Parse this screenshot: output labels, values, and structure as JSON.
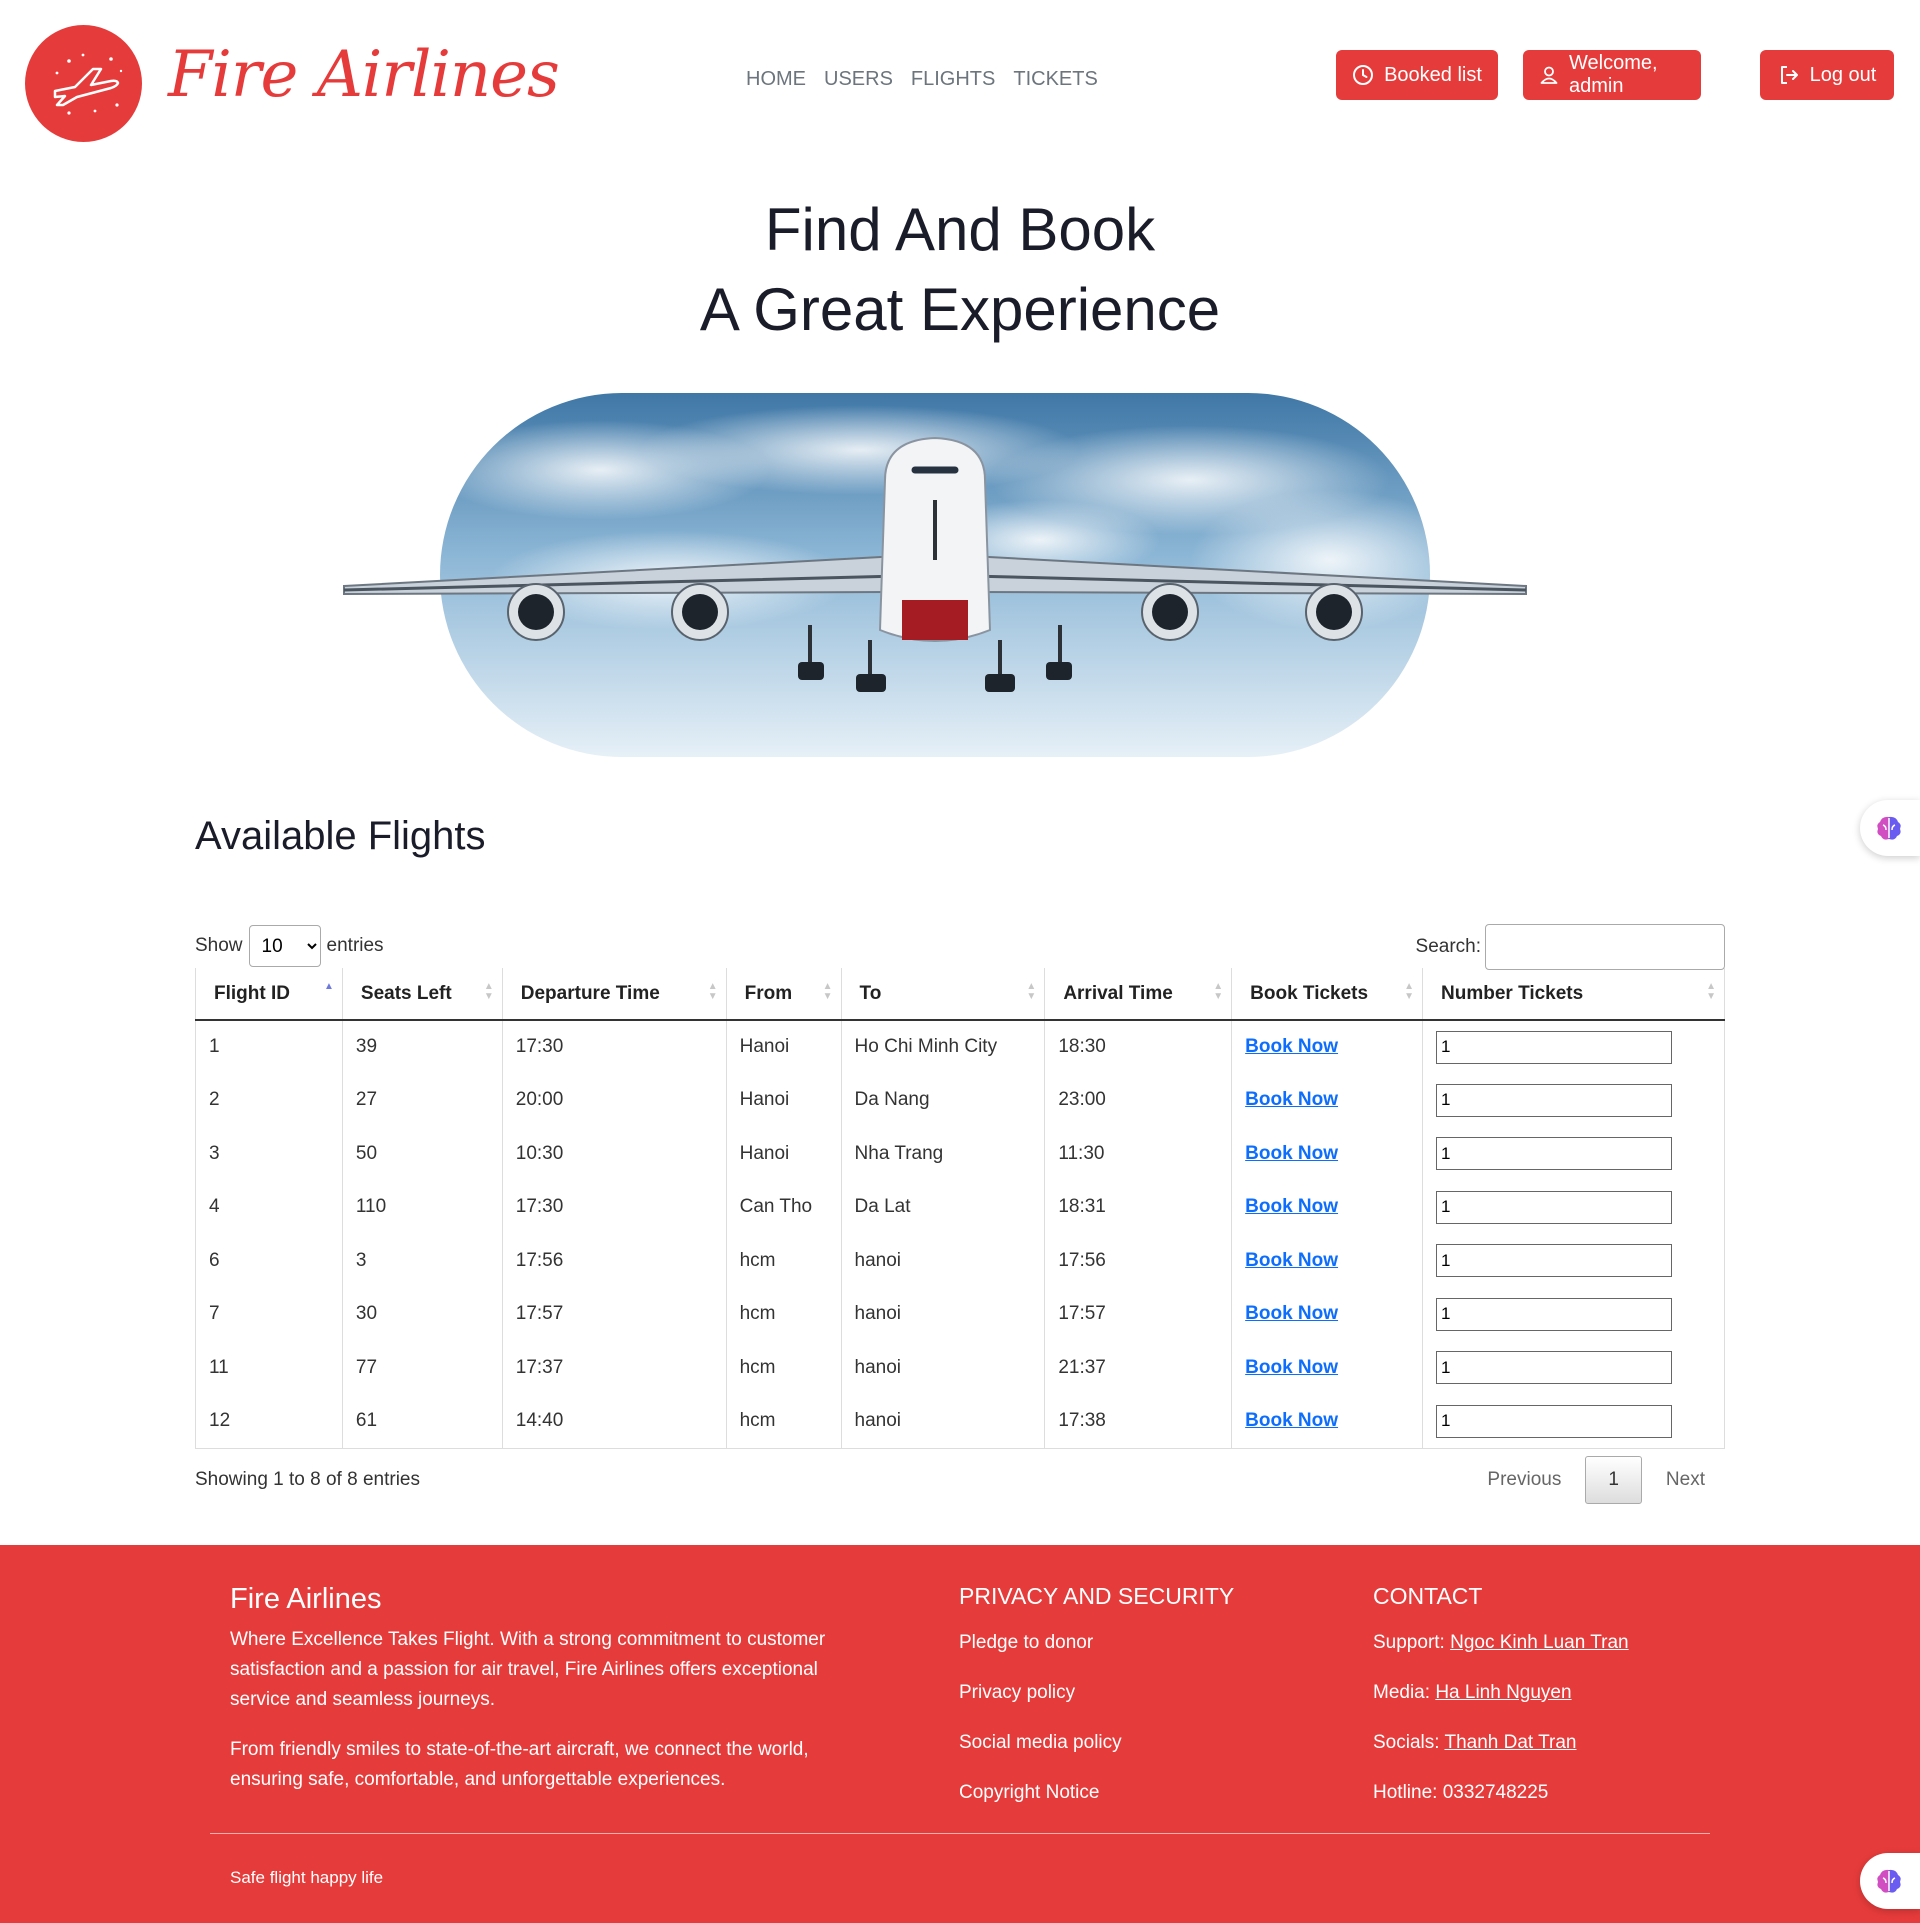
{
  "brand": {
    "name": "Fire Airlines",
    "logo_icon": "plane-logo"
  },
  "nav": [
    "HOME",
    "USERS",
    "FLIGHTS",
    "TICKETS"
  ],
  "header_buttons": {
    "booked": {
      "label": "Booked list",
      "icon": "clock-icon"
    },
    "welcome": {
      "label": "Welcome, admin",
      "icon": "user-icon"
    },
    "logout": {
      "label": "Log out",
      "icon": "logout-icon"
    }
  },
  "hero": {
    "line1": "Find And Book",
    "line2": "A Great Experience"
  },
  "section": {
    "title": "Available Flights"
  },
  "datatable": {
    "show_label": "Show",
    "entries_label": "entries",
    "length_value": "10",
    "search_label": "Search:",
    "search_value": "",
    "info": "Showing 1 to 8 of 8 entries",
    "previous": "Previous",
    "current_page": "1",
    "next": "Next",
    "columns": [
      "Flight ID",
      "Seats Left",
      "Departure Time",
      "From",
      "To",
      "Arrival Time",
      "Book Tickets",
      "Number Tickets"
    ],
    "sorted_column": "Flight ID",
    "rows": [
      {
        "id": "1",
        "seats": "39",
        "dep": "17:30",
        "from": "Hanoi",
        "to": "Ho Chi Minh City",
        "arr": "18:30",
        "book": "Book Now",
        "num": "1"
      },
      {
        "id": "2",
        "seats": "27",
        "dep": "20:00",
        "from": "Hanoi",
        "to": "Da Nang",
        "arr": "23:00",
        "book": "Book Now",
        "num": "1"
      },
      {
        "id": "3",
        "seats": "50",
        "dep": "10:30",
        "from": "Hanoi",
        "to": "Nha Trang",
        "arr": "11:30",
        "book": "Book Now",
        "num": "1"
      },
      {
        "id": "4",
        "seats": "110",
        "dep": "17:30",
        "from": "Can Tho",
        "to": "Da Lat",
        "arr": "18:31",
        "book": "Book Now",
        "num": "1"
      },
      {
        "id": "6",
        "seats": "3",
        "dep": "17:56",
        "from": "hcm",
        "to": "hanoi",
        "arr": "17:56",
        "book": "Book Now",
        "num": "1"
      },
      {
        "id": "7",
        "seats": "30",
        "dep": "17:57",
        "from": "hcm",
        "to": "hanoi",
        "arr": "17:57",
        "book": "Book Now",
        "num": "1"
      },
      {
        "id": "11",
        "seats": "77",
        "dep": "17:37",
        "from": "hcm",
        "to": "hanoi",
        "arr": "21:37",
        "book": "Book Now",
        "num": "1"
      },
      {
        "id": "12",
        "seats": "61",
        "dep": "14:40",
        "from": "hcm",
        "to": "hanoi",
        "arr": "17:38",
        "book": "Book Now",
        "num": "1"
      }
    ]
  },
  "footer": {
    "brand": "Fire Airlines",
    "about_1": "Where Excellence Takes Flight. With a strong commitment to customer satisfaction and a passion for air travel, Fire Airlines offers exceptional service and seamless journeys.",
    "about_2": "From friendly smiles to state-of-the-art aircraft, we connect the world, ensuring safe, comfortable, and unforgettable experiences.",
    "privacy": {
      "title": "PRIVACY AND SECURITY",
      "links": [
        "Pledge to donor",
        "Privacy policy",
        "Social media policy",
        "Copyright Notice"
      ]
    },
    "contact": {
      "title": "CONTACT",
      "support_label": "Support:",
      "support_name": "Ngoc Kinh Luan Tran",
      "media_label": "Media:",
      "media_name": "Ha Linh Nguyen",
      "socials_label": "Socials:",
      "socials_name": "Thanh Dat Tran",
      "hotline": "Hotline: 0332748225"
    },
    "tagline": "Safe flight happy life"
  },
  "colors": {
    "brand_red": "#e63b3b",
    "link_blue": "#0d6efd",
    "title_dark": "#1a1d29"
  },
  "widgets": {
    "icon": "brain-icon"
  }
}
